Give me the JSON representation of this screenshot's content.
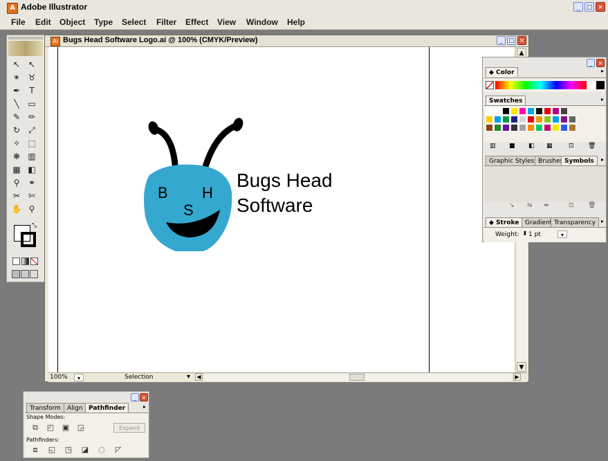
{
  "app": {
    "title": "Adobe Illustrator",
    "icon_letter": "A",
    "controls": [
      "_",
      "□",
      "×"
    ]
  },
  "menu": [
    "File",
    "Edit",
    "Object",
    "Type",
    "Select",
    "Filter",
    "Effect",
    "View",
    "Window",
    "Help"
  ],
  "toolbox": {
    "tools": [
      {
        "name": "selection-tool-icon",
        "glyph": "↖"
      },
      {
        "name": "direct-selection-tool-icon",
        "glyph": "↖"
      },
      {
        "name": "magic-wand-tool-icon",
        "glyph": "✴"
      },
      {
        "name": "lasso-tool-icon",
        "glyph": "♉"
      },
      {
        "name": "pen-tool-icon",
        "glyph": "✒"
      },
      {
        "name": "type-tool-icon",
        "glyph": "T"
      },
      {
        "name": "line-tool-icon",
        "glyph": "╲"
      },
      {
        "name": "rectangle-tool-icon",
        "glyph": "▭"
      },
      {
        "name": "paintbrush-tool-icon",
        "glyph": "✎"
      },
      {
        "name": "pencil-tool-icon",
        "glyph": "✏"
      },
      {
        "name": "rotate-tool-icon",
        "glyph": "↻"
      },
      {
        "name": "scale-tool-icon",
        "glyph": "⤢"
      },
      {
        "name": "warp-tool-icon",
        "glyph": "✧"
      },
      {
        "name": "free-transform-tool-icon",
        "glyph": "⬚"
      },
      {
        "name": "symbol-sprayer-tool-icon",
        "glyph": "❋"
      },
      {
        "name": "column-graph-tool-icon",
        "glyph": "▥"
      },
      {
        "name": "mesh-tool-icon",
        "glyph": "▦"
      },
      {
        "name": "gradient-tool-icon",
        "glyph": "◧"
      },
      {
        "name": "eyedropper-tool-icon",
        "glyph": "⚲"
      },
      {
        "name": "blend-tool-icon",
        "glyph": "⚭"
      },
      {
        "name": "slice-tool-icon",
        "glyph": "✂"
      },
      {
        "name": "scissors-tool-icon",
        "glyph": "✄"
      },
      {
        "name": "hand-tool-icon",
        "glyph": "✋"
      },
      {
        "name": "zoom-tool-icon",
        "glyph": "⚲"
      }
    ]
  },
  "document": {
    "title": "Bugs Head Software Logo.ai @ 100% (CMYK/Preview)",
    "zoom": "100%",
    "status": "Selection",
    "logo": {
      "letters": [
        "B",
        "H",
        "S"
      ],
      "text_line1": "Bugs Head",
      "text_line2": "Software",
      "head_color": "#35a8cf"
    }
  },
  "right_panel": {
    "color_tab": "◆ Color",
    "swatches_tab": "Swatches",
    "styles_tabs": [
      "Graphic Styles",
      "Brushes",
      "Symbols"
    ],
    "stroke_tabs": [
      "◆ Stroke",
      "Gradient",
      "Transparency"
    ],
    "weight_label": "Weight:",
    "weight_value": "1 pt",
    "swatch_colors_row1": [
      "#ffffff",
      "#ffffff",
      "#000000",
      "#ffe600",
      "#ff00aa",
      "#00aaee",
      "#111111",
      "#e60012",
      "#b20086",
      "#444444"
    ],
    "swatch_colors_row2": [
      "#fdd000",
      "#00a0e9",
      "#009944",
      "#1d2088",
      "#d6d6d6",
      "#e60012",
      "#f39800",
      "#8fc31f",
      "#00a0e9",
      "#920783",
      "#666666"
    ],
    "swatch_colors_row3": [
      "#8b4513",
      "#228b22",
      "#6a0dad",
      "#333333",
      "#a0a0a0",
      "#ff8800",
      "#00cc66",
      "#cc0066",
      "#eeee00",
      "#3355ff",
      "#aa7733"
    ]
  },
  "pathfinder_panel": {
    "tabs": [
      "Transform",
      "Align",
      "Pathfinder"
    ],
    "shape_modes_label": "Shape Modes:",
    "expand_label": "Expand",
    "pathfinders_label": "Pathfinders:"
  }
}
